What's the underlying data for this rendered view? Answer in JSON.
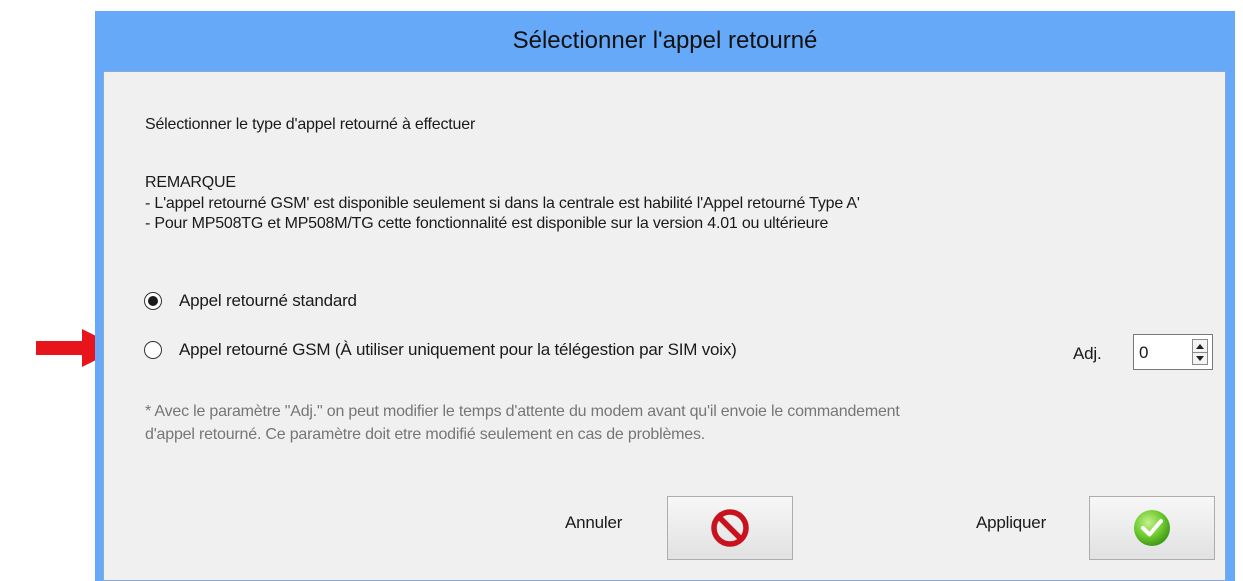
{
  "dialog": {
    "title": "Sélectionner l'appel retourné",
    "instruction": "Sélectionner le type d'appel retourné à effectuer",
    "remark_title": "REMARQUE",
    "remark_lines": [
      "- L'appel retourné GSM' est disponible seulement si dans la centrale est habilité l'Appel retourné Type A'",
      "- Pour MP508TG et MP508M/TG cette fonctionnalité est disponible sur la version 4.01 ou ultérieure"
    ],
    "options": [
      {
        "label": "Appel retourné standard",
        "checked": true
      },
      {
        "label": "Appel retourné GSM (À utiliser uniquement pour la télégestion par SIM voix)",
        "checked": false
      }
    ],
    "adj": {
      "label": "Adj.",
      "value": "0"
    },
    "note_lines": [
      "* Avec le paramètre \"Adj.\" on peut modifier le temps d'attente du modem avant qu'il envoie le commandement",
      "d'appel retourné. Ce paramètre doit etre modifié seulement en cas de problèmes."
    ],
    "buttons": {
      "cancel_label": "Annuler",
      "apply_label": "Appliquer"
    }
  },
  "icons": {
    "annotation": "red-arrow-icon",
    "cancel": "no-entry-icon",
    "apply": "green-check-icon"
  },
  "colors": {
    "title_bar": "#65a9f8",
    "client_bg": "#f0f0f0",
    "arrow": "#e8141c",
    "cancel_icon": "#c8121e",
    "apply_icon": "#5cc228",
    "note_text": "#767676"
  }
}
